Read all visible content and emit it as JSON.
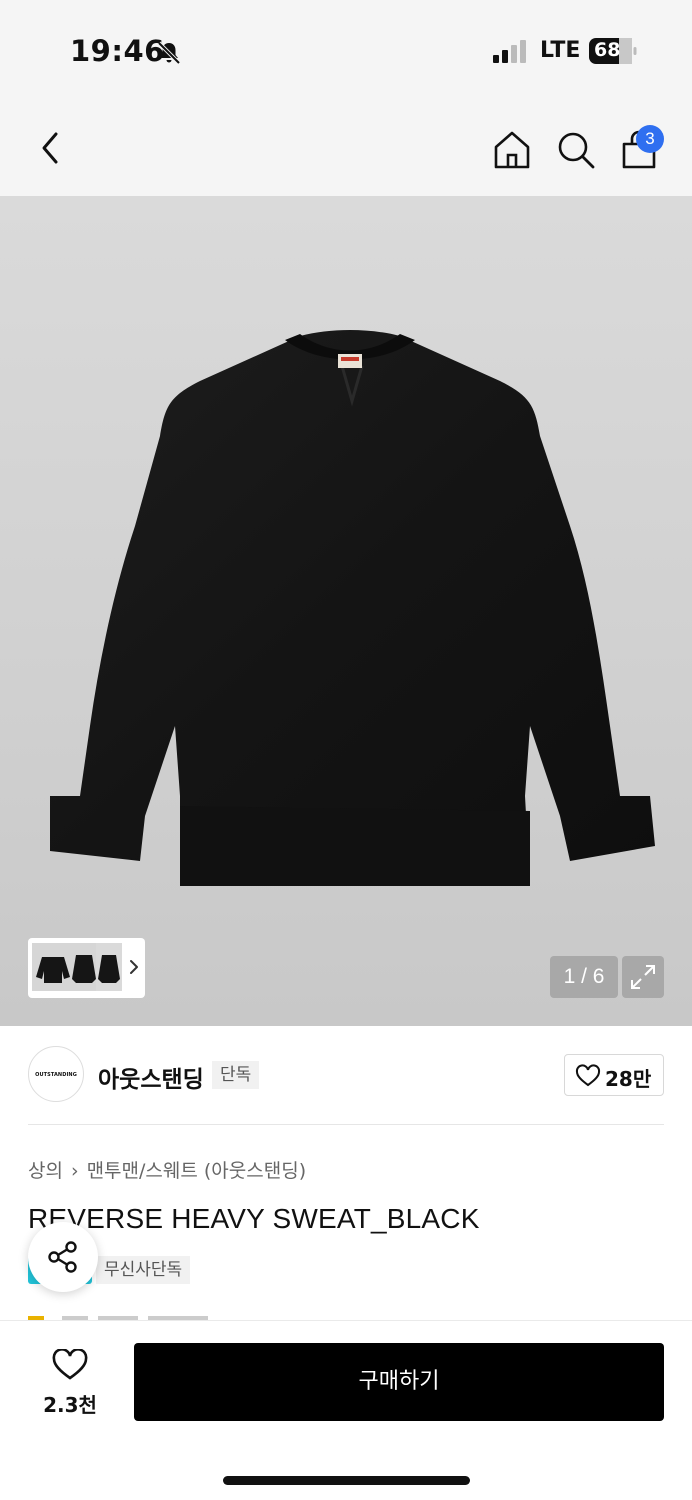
{
  "status_bar": {
    "time": "19:46",
    "network": "LTE",
    "battery": "68"
  },
  "nav": {
    "cart_count": "3"
  },
  "gallery": {
    "page_counter": "1 / 6"
  },
  "brand": {
    "logo_text": "OUTSTANDING",
    "name": "아웃스탠딩",
    "exclusive_tag": "단독",
    "like_count": "28만"
  },
  "product": {
    "breadcrumb": [
      "상의",
      "맨투맨/스웨트 (아웃스탠딩)"
    ],
    "title": "REVERSE HEAVY SWEAT_BLACK",
    "musinsa_tag": "무신사단독"
  },
  "bottom_bar": {
    "wish_count": "2.3천",
    "buy_label": "구매하기"
  },
  "colors": {
    "accent_badge": "#2f6ff0",
    "buy_button": "#000000",
    "musinsa_icon": "#22c4d9"
  }
}
